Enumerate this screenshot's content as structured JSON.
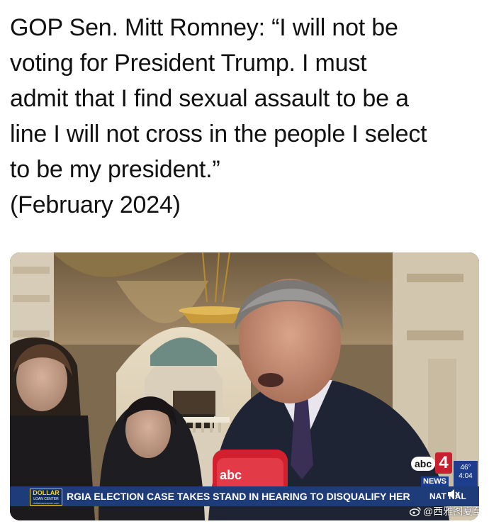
{
  "post": {
    "lines": [
      "GOP Sen. Mitt Romney: “I will not be",
      "voting for President Trump. I must",
      "admit that I find sexual assault to be a",
      "line I will not cross in the people I select",
      "to be my president.”",
      "(February 2024)"
    ]
  },
  "broadcast": {
    "logo_abc": "abc",
    "logo_number": "4",
    "logo_news": "NEWS",
    "mic_label": "abc",
    "weather_temp": "46°",
    "weather_time": "4:04",
    "brand_line1": "DOLLAR",
    "brand_line2": "LOAN CENTER",
    "brand_line3": "dollarloancenter.com",
    "headline": "RGIA ELECTION CASE TAKES STAND IN HEARING TO DISQUALIFY HER",
    "section": "NAT  NAL",
    "mute_icon": "speaker-mute-icon"
  },
  "watermark": {
    "text": "@西雅图夏至",
    "icon": "weibo-icon"
  },
  "colors": {
    "ticker_bg": "#1f3c7a",
    "brand_accent": "#f3d12b",
    "abc_red": "#c8202f"
  }
}
